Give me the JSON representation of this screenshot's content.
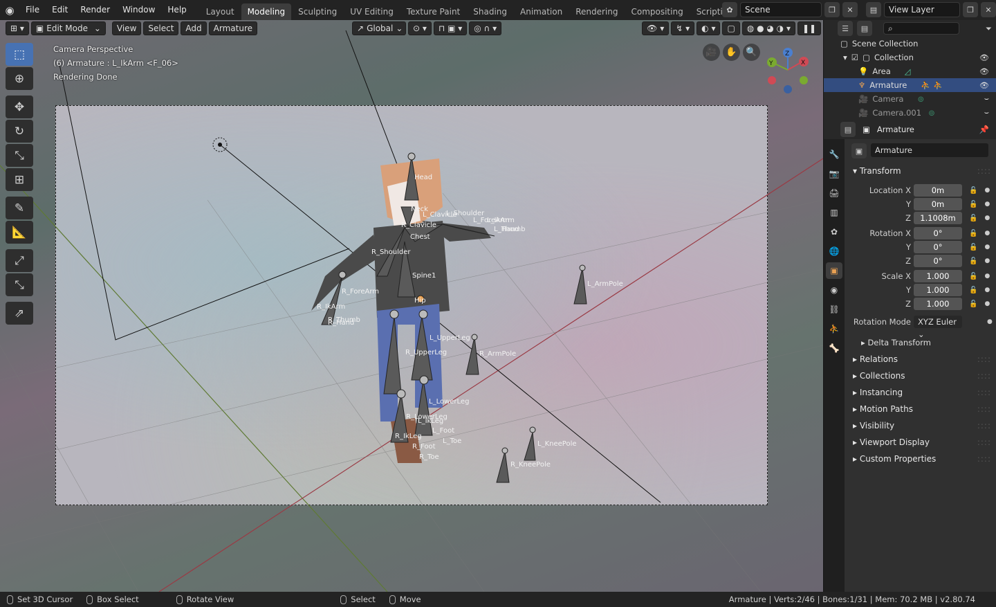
{
  "topbar": {
    "menu": [
      "File",
      "Edit",
      "Render",
      "Window",
      "Help"
    ],
    "workspaces": [
      "Layout",
      "Modeling",
      "Sculpting",
      "UV Editing",
      "Texture Paint",
      "Shading",
      "Animation",
      "Rendering",
      "Compositing",
      "Scripting"
    ],
    "active_workspace": "Modeling",
    "scene_name": "Scene",
    "view_layer": "View Layer"
  },
  "viewport_header": {
    "mode": "Edit Mode",
    "menus": [
      "View",
      "Select",
      "Add",
      "Armature"
    ],
    "orientation": "Global"
  },
  "overlay": {
    "line1": "Camera Perspective",
    "line2": "(6) Armature : L_IkArm <F_06>",
    "line3": "Rendering Done"
  },
  "bones": {
    "head": "Head",
    "neck": "Neck",
    "l_clavicle": "L_Clavicle",
    "l_shoulder": "L_Shoulder",
    "l_forearm": "L_ForeArm",
    "l_ikarm": "L_IkArm",
    "l_thumb": "L_Thumb",
    "l_hand": "L_Hand",
    "r_clavicle": "R_Clavicle",
    "chest": "Chest",
    "r_shoulder": "R_Shoulder",
    "spine1": "Spine1",
    "r_forearm": "R_ForeArm",
    "r_ikarm": "R_IkArm",
    "r_thumb": "R_Thumb",
    "r_hand": "R_Hand",
    "hip": "Hip",
    "l_upperleg": "L_UpperLeg",
    "r_upperleg": "R_UpperLeg",
    "r_armpole": "R_ArmPole",
    "l_armpole": "L_ArmPole",
    "l_lowerleg": "L_LowerLeg",
    "r_lowerleg": "R_LowerLeg",
    "l_ikleg": "L_IkLeg",
    "l_foot": "L_Foot",
    "l_toe": "L_Toe",
    "r_ikleg": "R_IkLeg",
    "r_foot": "R_Foot",
    "r_toe": "R_Toe",
    "l_kneepole": "L_KneePole",
    "r_kneepole": "R_KneePole"
  },
  "outliner": {
    "root": "Scene Collection",
    "collection": "Collection",
    "items": [
      "Area",
      "Armature",
      "Camera",
      "Camera.001"
    ]
  },
  "properties": {
    "header_object": "Armature",
    "object_name": "Armature",
    "transform_title": "Transform",
    "location": {
      "label": "Location X",
      "x": "0m",
      "y": "0m",
      "z": "1.1008m"
    },
    "rotation": {
      "label": "Rotation X",
      "x": "0°",
      "y": "0°",
      "z": "0°"
    },
    "scale": {
      "label": "Scale X",
      "x": "1.000",
      "y": "1.000",
      "z": "1.000"
    },
    "axis_y": "Y",
    "axis_z": "Z",
    "rotation_mode_label": "Rotation Mode",
    "rotation_mode": "XYZ Euler",
    "delta_transform": "Delta Transform",
    "sections": [
      "Relations",
      "Collections",
      "Instancing",
      "Motion Paths",
      "Visibility",
      "Viewport Display",
      "Custom Properties"
    ]
  },
  "statusbar": {
    "set_cursor": "Set 3D Cursor",
    "box_select": "Box Select",
    "rotate_view": "Rotate View",
    "select": "Select",
    "move": "Move",
    "stats": "Armature | Verts:2/46 | Bones:1/31 | Mem: 70.2 MB | v2.80.74"
  },
  "colors": {
    "accent": "#4772b3",
    "selected_row": "#334d80",
    "active_tab": "#e8a052"
  }
}
